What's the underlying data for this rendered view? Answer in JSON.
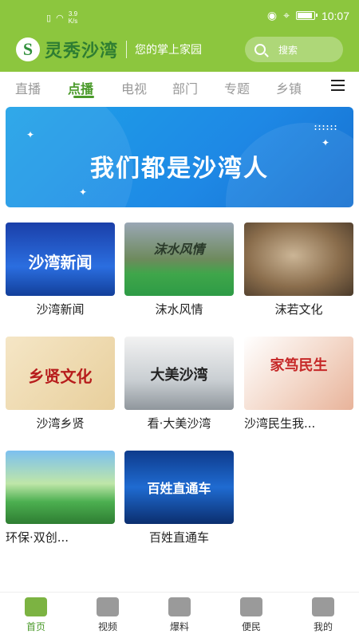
{
  "status": {
    "speed_value": "3.9",
    "speed_unit": "K/s",
    "time": "10:07",
    "battery_level": 0.8
  },
  "header": {
    "logo_text": "灵秀沙湾",
    "slogan": "您的掌上家园",
    "search_placeholder": "搜索"
  },
  "tabs": [
    "直播",
    "点播",
    "电视",
    "部门",
    "专题",
    "乡镇"
  ],
  "active_tab": "点播",
  "banner": {
    "text": "我们都是沙湾人"
  },
  "cards": [
    {
      "title": "沙湾新闻",
      "overlay": "沙湾新闻"
    },
    {
      "title": "沫水风情",
      "overlay": "沫水风情"
    },
    {
      "title": "沫若文化",
      "overlay": ""
    },
    {
      "title": "沙湾乡贤",
      "overlay": "乡贤文化"
    },
    {
      "title": "看·大美沙湾",
      "overlay": "大美沙湾"
    },
    {
      "title": "沙湾民生我...",
      "overlay": "家笃民生"
    },
    {
      "title": "环保·双创...",
      "overlay": ""
    },
    {
      "title": "百姓直通车",
      "overlay": "百姓直通车"
    }
  ],
  "bottom_nav": [
    {
      "label": "首页",
      "icon": "home-icon"
    },
    {
      "label": "视频",
      "icon": "video-icon"
    },
    {
      "label": "爆料",
      "icon": "report-icon"
    },
    {
      "label": "便民",
      "icon": "services-icon"
    },
    {
      "label": "我的",
      "icon": "profile-icon"
    }
  ],
  "colors": {
    "brand_green": "#8cc63e",
    "accent_green": "#4a9a2a",
    "banner_blue": "#1e88e5"
  }
}
